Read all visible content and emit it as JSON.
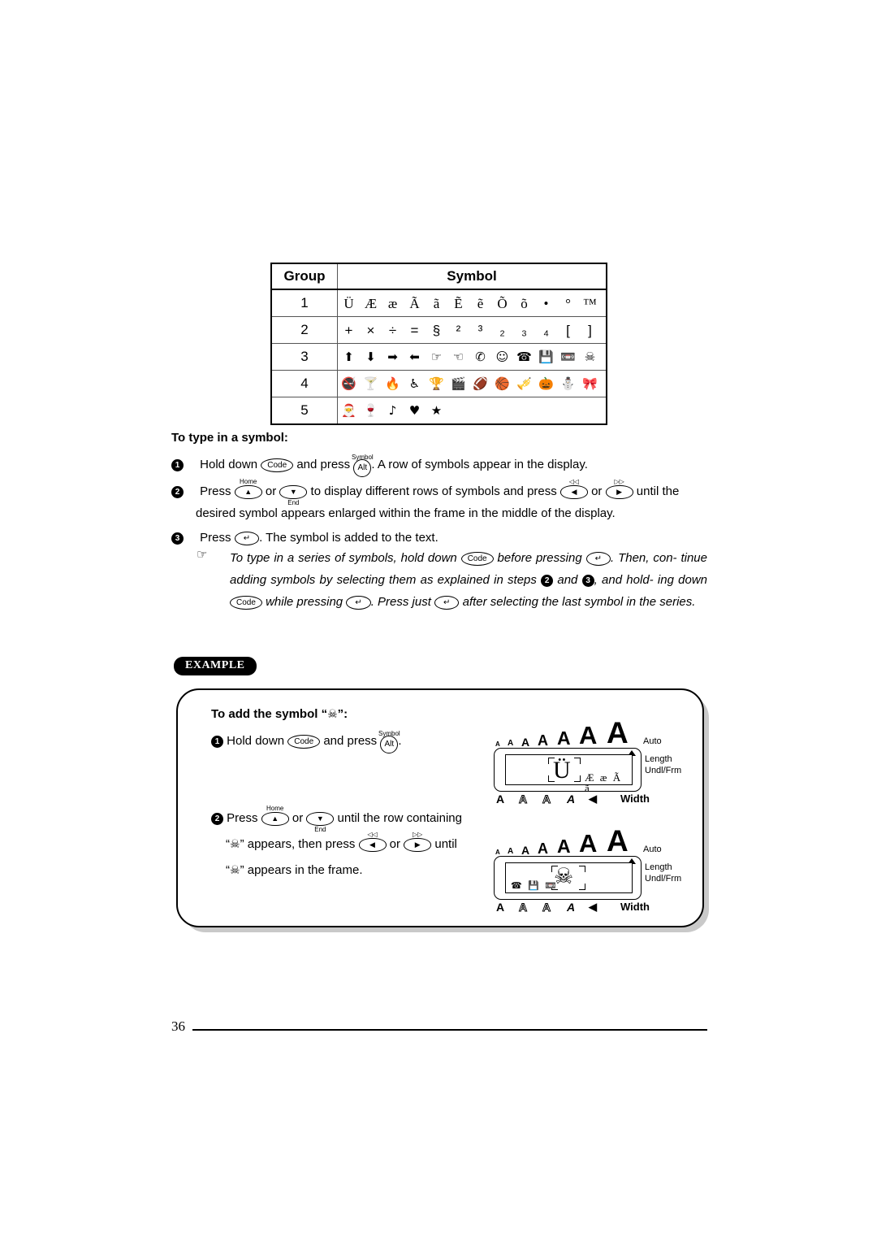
{
  "page": {
    "number": "36"
  },
  "symbol_table": {
    "headers": [
      "Group",
      "Symbol"
    ],
    "rows": [
      {
        "group": "1",
        "symbols": [
          "Ü",
          "Æ",
          "æ",
          "Ã",
          "ã",
          "Ẽ",
          "ẽ",
          "Õ",
          "õ",
          "•",
          "°",
          "™"
        ]
      },
      {
        "group": "2",
        "symbols": [
          "+",
          "×",
          "÷",
          "=",
          "§",
          "²",
          "³",
          "₂",
          "₃",
          "₄",
          "[",
          "]"
        ]
      },
      {
        "group": "3",
        "symbols": [
          "⬆",
          "⬇",
          "➡",
          "⬅",
          "☞",
          "☜",
          "✆",
          "☺",
          "☎",
          "💾",
          "📼",
          "☠"
        ]
      },
      {
        "group": "4",
        "symbols": [
          "🚭",
          "🍸",
          "🔥",
          "♿",
          "🏆",
          "🎬",
          "🏈",
          "🏀",
          "🎺",
          "🎃",
          "⛄",
          "🎀"
        ]
      },
      {
        "group": "5",
        "symbols": [
          "🎅",
          "🍷",
          "♪",
          "♥",
          "★"
        ]
      }
    ]
  },
  "instructions": {
    "title": "To type in a symbol:",
    "step1": {
      "num": "1",
      "text_a": "Hold down",
      "key_code": "Code",
      "text_b": "and press",
      "key_alt": "Alt",
      "key_alt_above": "Symbol",
      "text_c": ". A row of symbols appear in the display."
    },
    "step2": {
      "num": "2",
      "text_a": "Press",
      "key_up_above": "Home",
      "key_up": "▲",
      "text_b": "or",
      "key_down": "▼",
      "key_down_below": "End",
      "text_c": "to display different rows of symbols and press",
      "key_left_above": "◁◁",
      "key_left": "◀",
      "text_d": "or",
      "key_right_above": "▷▷",
      "key_right": "▶",
      "text_e": "until the",
      "line2": "desired symbol appears enlarged within the frame in the middle of the display."
    },
    "step3": {
      "num": "3",
      "text_a": "Press",
      "key_return": "↵",
      "text_b": ". The symbol is added to the text."
    },
    "note": {
      "hand_icon": "☞",
      "line1_a": "To type in a series of symbols, hold down",
      "line1_key": "Code",
      "line1_b": "before pressing",
      "line1_key2": "↵",
      "line1_c": ". Then, con-",
      "line2_a": "tinue adding symbols by selecting them as explained in steps",
      "line2_num1": "2",
      "line2_b": "and",
      "line2_num2": "3",
      "line2_c": ", and hold-",
      "line3_a": "ing down",
      "line3_key": "Code",
      "line3_b": "while pressing",
      "line3_key2": "↵",
      "line3_c": ". Press just",
      "line3_key3": "↵",
      "line3_d": "after selecting the last",
      "line4": "symbol in the series."
    }
  },
  "example": {
    "badge": "EXAMPLE",
    "title_a": "To add the symbol “",
    "title_symbol": "☠",
    "title_b": "”:",
    "step1": {
      "num": "1",
      "text_a": "Hold down",
      "key_code": "Code",
      "text_b": "and press",
      "key_alt": "Alt",
      "key_alt_above": "Symbol",
      "text_c": "."
    },
    "step2": {
      "num": "2",
      "text_a": "Press",
      "key_up_above": "Home",
      "key_up": "▲",
      "text_b": "or",
      "key_down": "▼",
      "key_down_below": "End",
      "text_c": "until the row containing",
      "line2_q1": "“",
      "line2_symbol": "☠",
      "line2_q2": "”",
      "line2_a": "appears, then press",
      "key_left_above": "◁◁",
      "key_left": "◀",
      "line2_b": "or",
      "key_right_above": "▷▷",
      "key_right": "▶",
      "line2_c": "until",
      "line3_q1": "“",
      "line3_symbol": "☠",
      "line3_q2": "”",
      "line3_a": "appears in the frame."
    },
    "lcd1": {
      "size_indicators": [
        "A",
        "A",
        "A",
        "A",
        "A",
        "A",
        "A"
      ],
      "auto_label": "Auto",
      "length_label": "Length",
      "undl_label": "Undl/Frm",
      "width_label": "Width",
      "style_indicators": [
        "A",
        "A",
        "A",
        "A",
        "◀"
      ],
      "framed_char": "Ü",
      "trailing_chars": "Æ æ Ã ã",
      "leading_chars": ""
    },
    "lcd2": {
      "size_indicators": [
        "A",
        "A",
        "A",
        "A",
        "A",
        "A",
        "A"
      ],
      "auto_label": "Auto",
      "length_label": "Length",
      "undl_label": "Undl/Frm",
      "width_label": "Width",
      "style_indicators": [
        "A",
        "A",
        "A",
        "A",
        "◀"
      ],
      "framed_char": "☠",
      "trailing_chars": "",
      "leading_chars": "☎ 💾 📼"
    }
  }
}
